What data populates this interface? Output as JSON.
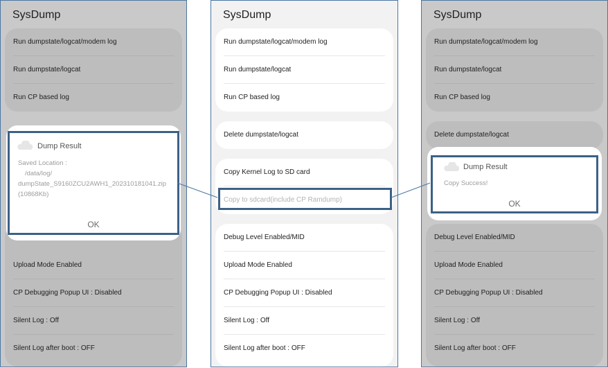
{
  "app_title": "SysDump",
  "menu": {
    "run_full": "Run dumpstate/logcat/modem log",
    "run_dumpstate": "Run dumpstate/logcat",
    "run_cp": "Run CP based log",
    "delete": "Delete dumpstate/logcat",
    "copy_kernel": "Copy Kernel Log to SD card",
    "copy_sdcard": "Copy to sdcard(include CP Ramdump)",
    "debug_level": "Debug Level Enabled/MID",
    "upload_mode": "Upload Mode Enabled",
    "cp_popup": "CP Debugging Popup UI : Disabled",
    "silent_log": "Silent Log : Off",
    "silent_boot": "Silent Log after boot : OFF"
  },
  "dialog_left": {
    "title": "Dump Result",
    "label": "Saved Location :",
    "path1": "/data/log/",
    "path2": "dumpState_S9160ZCU2AWH1_202310181041.zip",
    "size": "(10868Kb)",
    "ok": "OK"
  },
  "dialog_right": {
    "title": "Dump Result",
    "message": "Copy Success!",
    "ok": "OK"
  },
  "colors": {
    "highlight": "#3c6186",
    "connector": "#4a77a3",
    "dim_background": "#c9c9c9"
  }
}
